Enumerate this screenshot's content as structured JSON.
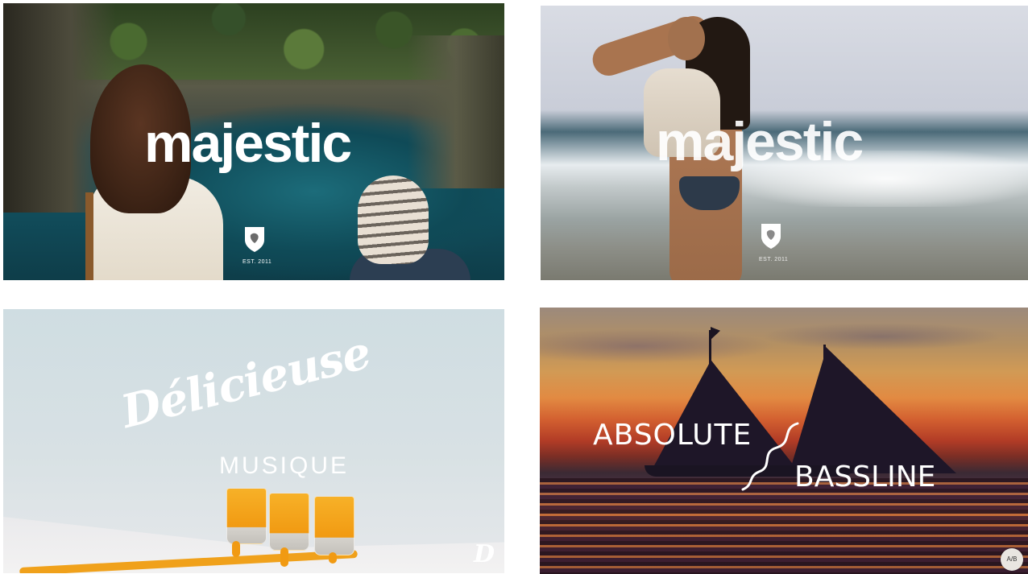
{
  "tiles": [
    {
      "label": "majestic",
      "badge": "EST. 2011",
      "icon": "lion-shield-icon"
    },
    {
      "label": "majestic",
      "badge": "EST. 2011",
      "icon": "lion-shield-icon"
    },
    {
      "title": "Délicieuse",
      "subtitle": "MUSIQUE",
      "mark": "D"
    },
    {
      "word1": "ABSOLUTE",
      "word2": "BASSLINE",
      "badge": "A/B"
    }
  ],
  "colors": {
    "text": "#ffffff",
    "background": "#ffffff",
    "juice": "#f19a12",
    "sail": "#1e1628"
  }
}
